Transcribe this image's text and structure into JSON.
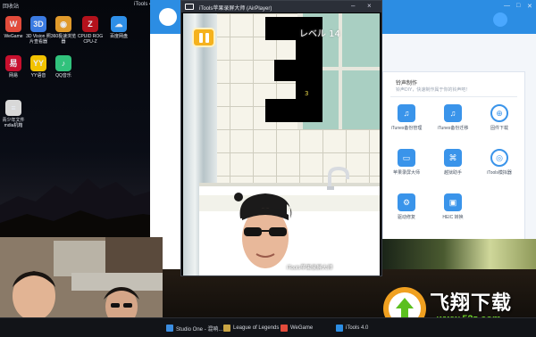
{
  "desktop": {
    "top_left_label": "回收站",
    "top_right_label": "iTools 4",
    "icons": [
      {
        "label": "WeGame",
        "glyph": "W",
        "color": "#e24b3b"
      },
      {
        "label": "3D Vision 照片查看器",
        "glyph": "3D",
        "color": "#3b7be2"
      },
      {
        "label": "360极速浏览器",
        "glyph": "◉",
        "color": "#e09a2b"
      },
      {
        "label": "CPUID ROG CPU-Z",
        "glyph": "Z",
        "color": "#b3121c"
      },
      {
        "label": "百度网盘",
        "glyph": "☁",
        "color": "#2e8fe8"
      },
      {
        "label": "网易",
        "glyph": "易",
        "color": "#c8102e"
      },
      {
        "label": "YY语音",
        "glyph": "YY",
        "color": "#f2c200"
      },
      {
        "label": "QQ音乐",
        "glyph": "♪",
        "color": "#31c27c"
      },
      {
        "label": "青少年文件 mdia机箱",
        "glyph": "≡",
        "color": "#d8d8d8"
      }
    ]
  },
  "itools": {
    "panel_title": "铃声制作",
    "panel_subtitle": "铃声DIY，快速制作属于你的铃声吧！",
    "tools": [
      {
        "label": "iTunes备份管理",
        "glyph": "♫",
        "round": false
      },
      {
        "label": "iTunes备份迁移",
        "glyph": "♫",
        "round": false
      },
      {
        "label": "固件下载",
        "glyph": "⊕",
        "round": true
      },
      {
        "label": "苹果录屏大师",
        "glyph": "▭",
        "round": false
      },
      {
        "label": "越狱助手",
        "glyph": "⌘",
        "round": false
      },
      {
        "label": "iTools模拟器",
        "glyph": "◎",
        "round": true
      },
      {
        "label": "驱动修复",
        "glyph": "⚙",
        "round": false
      },
      {
        "label": "HEIC 转换",
        "glyph": "▣",
        "round": false
      }
    ]
  },
  "airplayer": {
    "title": "iTools苹果录屏大师 (AirPlayer)",
    "countdown": "3",
    "level_text": "レベル 14",
    "watermark": "iTools苹果录屏大师"
  },
  "taskbar": {
    "items": [
      {
        "label": "Studio One - 混响...",
        "color": "#3b8de0"
      },
      {
        "label": "League of Legends",
        "color": "#c9a543"
      },
      {
        "label": "WeGame",
        "color": "#e24b3b"
      },
      {
        "label": "iTools 4.0",
        "color": "#2c8de3"
      }
    ]
  },
  "site": {
    "name": "飞翔下载",
    "url": "www.52z.com"
  },
  "colors": {
    "itools_blue": "#2c8de3",
    "pause_yellow": "#f5b21e",
    "site_green": "#6fd12b"
  }
}
